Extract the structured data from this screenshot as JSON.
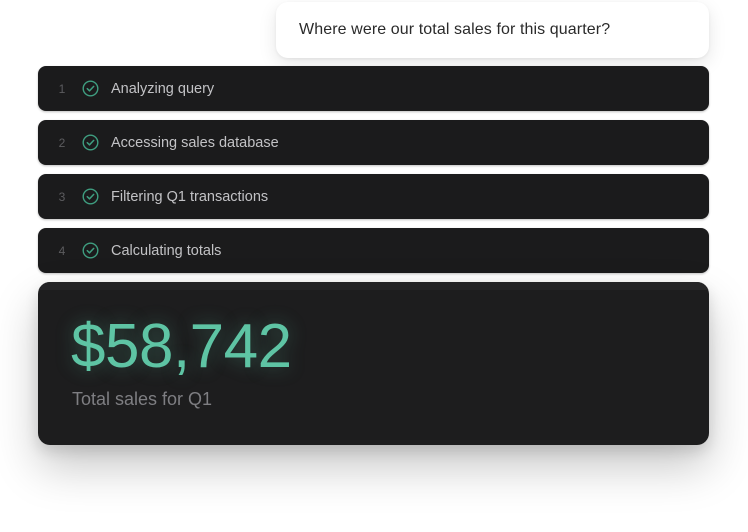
{
  "query": {
    "text": "Where were our total sales for this quarter?"
  },
  "steps": [
    {
      "number": "1",
      "label": "Analyzing query",
      "status": "complete",
      "icon": "check-circle-icon"
    },
    {
      "number": "2",
      "label": "Accessing sales database",
      "status": "complete",
      "icon": "check-circle-icon"
    },
    {
      "number": "3",
      "label": "Filtering Q1 transactions",
      "status": "complete",
      "icon": "check-circle-icon"
    },
    {
      "number": "4",
      "label": "Calculating totals",
      "status": "complete",
      "icon": "check-circle-icon"
    }
  ],
  "result": {
    "value": "$58,742",
    "caption": "Total sales for Q1"
  },
  "colors": {
    "accent": "#5ec4a4",
    "card_background": "#1b1b1c",
    "step_label": "#c2c2c5",
    "check_icon": "#3f9e80"
  }
}
